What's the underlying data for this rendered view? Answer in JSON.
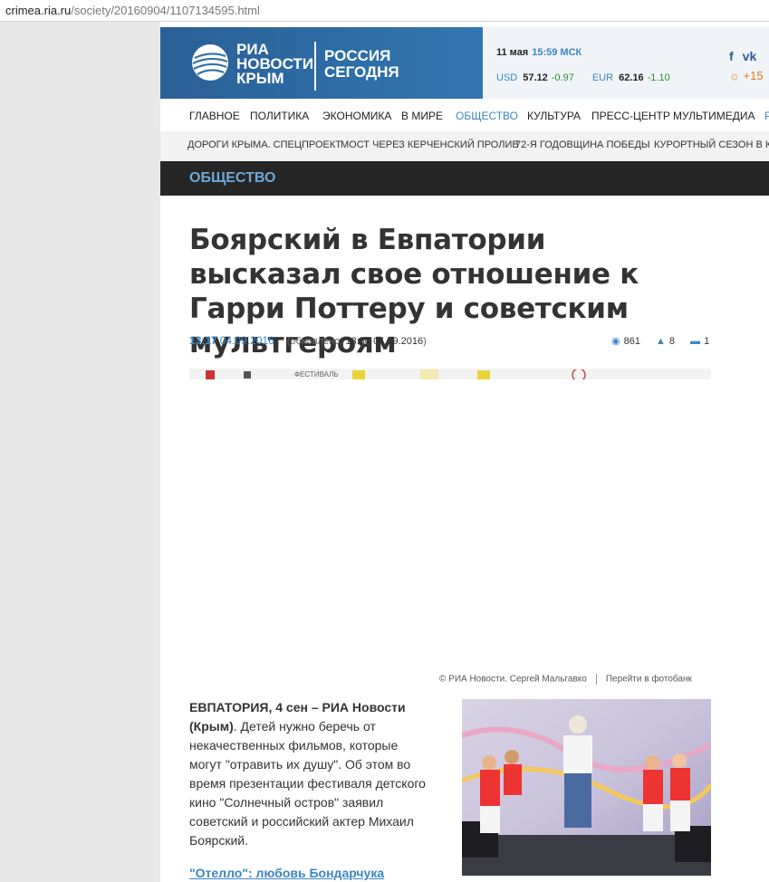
{
  "browser": {
    "url_host": "crimea.ria.ru",
    "url_path": "/society/20160904/1107134595.html"
  },
  "header": {
    "logo_lines": [
      "РИА",
      "НОВОСТИ",
      "КРЫМ"
    ],
    "russia_lines": [
      "РОССИЯ",
      "СЕГОДНЯ"
    ],
    "date": "11 мая",
    "time": "15:59 МСК",
    "rates": [
      {
        "currency": "USD",
        "value": "57.12",
        "change": "-0.97"
      },
      {
        "currency": "EUR",
        "value": "62.16",
        "change": "-1.10"
      }
    ],
    "weather": "+15",
    "social": [
      "f",
      "vk"
    ]
  },
  "nav": [
    "ГЛАВНОЕ",
    "ПОЛИТИКА",
    "ЭКОНОМИКА",
    "В МИРЕ",
    "ОБЩЕСТВО",
    "КУЛЬТУРА",
    "ПРЕСС-ЦЕНТР",
    "МУЛЬТИМЕДИА",
    "Р"
  ],
  "nav_active": "ОБЩЕСТВО",
  "subnav": [
    "ДОРОГИ КРЫМА. СПЕЦПРОЕКТ",
    "МОСТ ЧЕРЕЗ КЕРЧЕНСКИЙ ПРОЛИВ",
    "72-Я ГОДОВЩИНА ПОБЕДЫ",
    "КУРОРТНЫЙ СЕЗОН В КР"
  ],
  "section": "ОБЩЕСТВО",
  "article": {
    "headline": "Боярский в Евпатории высказал свое отношение к Гарри Поттеру и советским мультгероям",
    "time": "13:17",
    "date": "04.09.2016",
    "updated_prefix": "(обновлено: ",
    "updated_value": "13:30 04.09.2016",
    "updated_suffix": ")",
    "views": "861",
    "likes": "8",
    "comments": "1",
    "photo_credit": "© РИА Новости. Сергей Мальгавко",
    "photobank_link": "Перейти в фотобанк",
    "lead": "ЕВПАТОРИЯ, 4 сен – РИА Новости (Крым)",
    "body": ". Детей нужно беречь от некачественных фильмов, которые могут \"отравить их душу\". Об этом во время презентации фестиваля детского кино \"Солнечный остров\" заявил советский и российский актер Михаил Боярский.",
    "related_link": "\"Отелло\": любовь Бондарчука",
    "photo_strip_text": "ФЕСТИВАЛЬ"
  }
}
